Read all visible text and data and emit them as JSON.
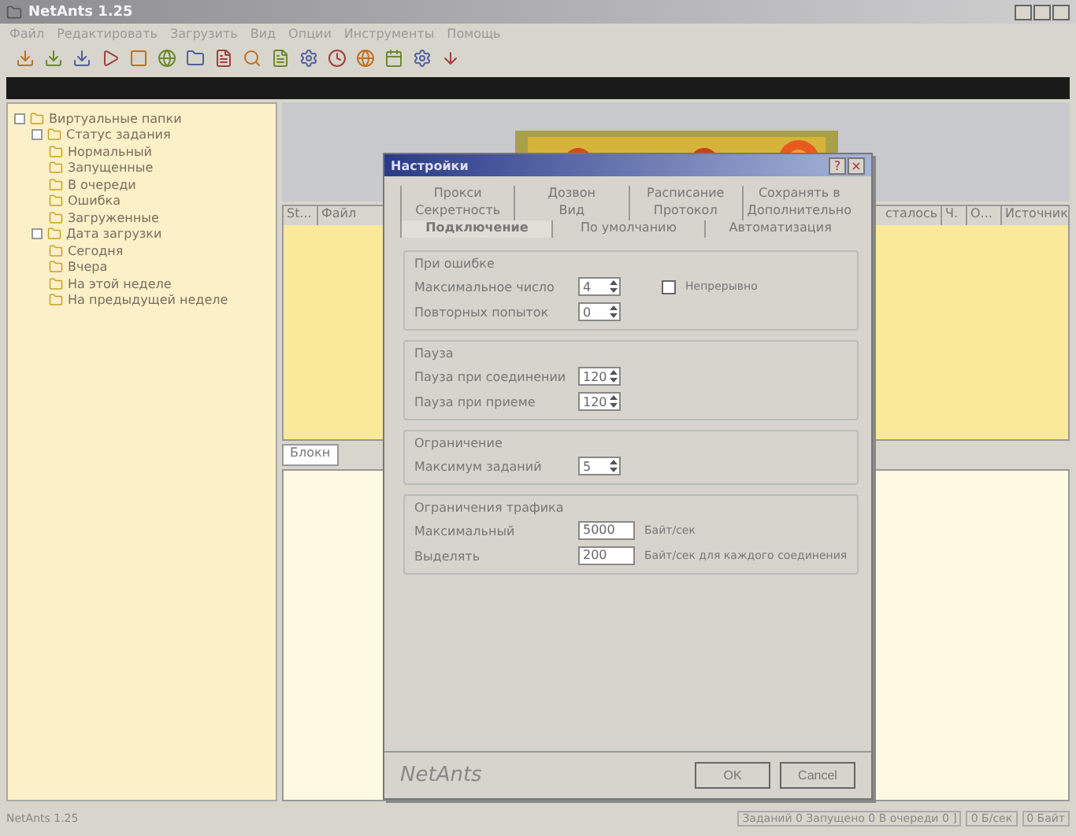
{
  "window": {
    "title": "NetAnts 1.25"
  },
  "menu": [
    "Файл",
    "Редактировать",
    "Загрузить",
    "Вид",
    "Опции",
    "Инструменты",
    "Помощь"
  ],
  "tree": [
    {
      "label": "Виртуальные папки",
      "expanded": true,
      "children": [
        {
          "label": "Статус задания",
          "expanded": true,
          "children": [
            {
              "label": "Нормальный"
            },
            {
              "label": "Запущенные"
            },
            {
              "label": "В очереди"
            },
            {
              "label": "Ошибка"
            },
            {
              "label": "Загруженные"
            }
          ]
        },
        {
          "label": "Дата загрузки",
          "expanded": true,
          "children": [
            {
              "label": "Сегодня"
            },
            {
              "label": "Вчера"
            },
            {
              "label": "На этой неделе"
            },
            {
              "label": "На предыдущей неделе"
            }
          ]
        }
      ]
    }
  ],
  "table": {
    "columns": [
      "St...",
      "Файл",
      "сталось",
      "Ч.",
      "О...",
      "Источник"
    ]
  },
  "bottom_tabs": [
    {
      "label": "Блокн",
      "selected": true
    }
  ],
  "dialog": {
    "title": "Настройки",
    "help": "?",
    "close": "×",
    "tab_rows": [
      [
        {
          "label": "Прокси",
          "selected": false
        },
        {
          "label": "Дозвон",
          "selected": false
        },
        {
          "label": "Расписание",
          "selected": false
        },
        {
          "label": "Сохранять в",
          "selected": false
        }
      ],
      [
        {
          "label": "Секретность",
          "selected": false
        },
        {
          "label": "Вид",
          "selected": false
        },
        {
          "label": "Протокол",
          "selected": false
        },
        {
          "label": "Дополнительно",
          "selected": false
        }
      ],
      [
        {
          "label": "Подключение",
          "selected": true
        },
        {
          "label": "По умолчанию",
          "selected": false
        },
        {
          "label": "Автоматизация",
          "selected": false
        }
      ]
    ],
    "groups": [
      {
        "title": "При ошибке",
        "rows": [
          {
            "kind": "spin",
            "label": "Максимальное число",
            "value": "4"
          },
          {
            "kind": "spin",
            "label": "Повторных попыток",
            "value": "0"
          }
        ],
        "checkbox": {
          "label": "Непрерывно",
          "checked": false
        }
      },
      {
        "title": "Пауза",
        "rows": [
          {
            "kind": "spin",
            "label": "Пауза при соединении",
            "value": "120"
          },
          {
            "kind": "spin",
            "label": "Пауза при приеме",
            "value": "120"
          }
        ]
      },
      {
        "title": "Ограничение",
        "rows": [
          {
            "kind": "spin",
            "label": "Максимум заданий",
            "value": "5"
          }
        ]
      },
      {
        "title": "Ограничения трафика",
        "rows": [
          {
            "kind": "text",
            "label": "Максимальный",
            "value": "5000",
            "unit": "Байт/сек"
          },
          {
            "kind": "text",
            "label": "Выделять",
            "value": "200",
            "unit": "Байт/сек для каждого соединения"
          }
        ]
      }
    ],
    "brand": "NetAnts",
    "buttons": [
      "OK",
      "Cancel"
    ]
  },
  "status_bar": {
    "app": "NetAnts 1.25",
    "cells": [
      "Заданий 0 Запущено 0 В очереди 0 ]",
      "0 Б/сек",
      "0 Байт"
    ]
  }
}
